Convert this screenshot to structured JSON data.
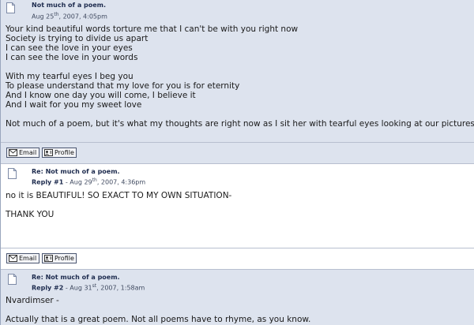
{
  "posts": [
    {
      "title": "Not much of a poem.",
      "date_prefix": "Aug 25",
      "date_sup": "th",
      "date_suffix": ", 2007, 4:05pm",
      "lines": [
        "Your kind beautiful words torture me that I can't be with you right now",
        "Society is trying to divide us apart",
        "I can see the love in your eyes",
        "I can see the love in your words",
        "With my tearful eyes I beg you",
        "To please understand that my love for you is for eternity",
        "And I know one day you will come, I believe it",
        "And I wait for you my sweet love",
        "Not much of a poem, but it's what my thoughts are right now as I sit her with tearful eyes looking at our pictures."
      ],
      "email_label": "Email",
      "profile_label": "Profile"
    },
    {
      "title": "Re: Not much of a poem.",
      "reply_label": "Reply #1",
      "date_prefix": " - Aug 29",
      "date_sup": "th",
      "date_suffix": ", 2007, 4:36pm",
      "lines": [
        "no it is BEAUTIFUL! SO EXACT TO MY OWN SITUATION-",
        "THANK YOU"
      ],
      "email_label": "Email",
      "profile_label": "Profile"
    },
    {
      "title": "Re: Not much of a poem.",
      "reply_label": "Reply #2",
      "date_prefix": " - Aug 31",
      "date_sup": "st",
      "date_suffix": ", 2007, 1:58am",
      "lines": [
        "Nvardimser -",
        "Actually that is a great poem.  Not all poems have to rhyme, as you know."
      ]
    }
  ],
  "icons": {
    "post": "document-icon",
    "email": "envelope-icon",
    "profile": "profile-card-icon"
  }
}
